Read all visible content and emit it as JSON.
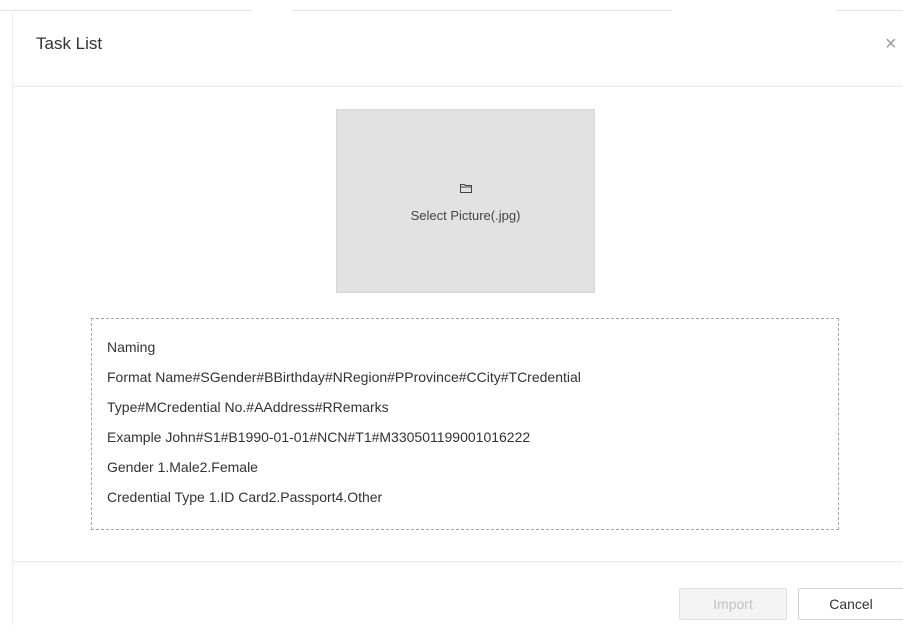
{
  "dialog": {
    "title": "Task List",
    "close_symbol": "×",
    "close_icon": "close-icon"
  },
  "picture_select": {
    "icon": "folder-icon",
    "label": "Select Picture(.jpg)"
  },
  "naming_info": {
    "lines": [
      "Naming",
      "Format  Name#SGender#BBirthday#NRegion#PProvince#CCity#TCredential",
      "Type#MCredential No.#AAddress#RRemarks",
      "Example  John#S1#B1990-01-01#NCN#T1#M330501199001016222",
      "Gender  1.Male2.Female",
      "Credential Type  1.ID Card2.Passport4.Other"
    ]
  },
  "footer": {
    "import_label": "Import",
    "cancel_label": "Cancel"
  }
}
